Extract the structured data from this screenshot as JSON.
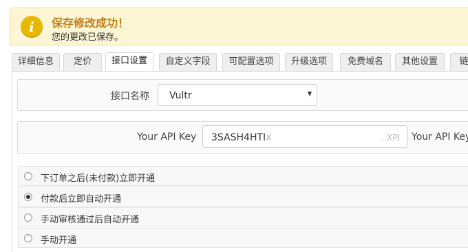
{
  "banner": {
    "icon": "info-icon",
    "icon_glyph": "i",
    "title": "保存修改成功！",
    "subtitle": "您的更改已保存。",
    "title_color": "#c47e18",
    "background": "#fdf6d4"
  },
  "tabs": [
    {
      "label": "详细信息",
      "active": false
    },
    {
      "label": "定价",
      "active": false
    },
    {
      "label": "接口设置",
      "active": true
    },
    {
      "label": "自定义字段",
      "active": false
    },
    {
      "label": "可配置选项",
      "active": false
    },
    {
      "label": "升级选项",
      "active": false
    },
    {
      "label": "免费域名",
      "active": false
    },
    {
      "label": "其他设置",
      "active": false
    },
    {
      "label": "链",
      "active": false
    }
  ],
  "module": {
    "label": "接口名称",
    "selected": "Vultr"
  },
  "api_key": {
    "label": "Your API Key",
    "value_visible": "3SASH4HTI",
    "value_faint": "XZI",
    "tail": "..XPI",
    "trailing_label": "Your API Key"
  },
  "provisioning": {
    "options": [
      {
        "label": "下订单之后(未付款)立即开通",
        "checked": false
      },
      {
        "label": "付款后立即自动开通",
        "checked": true
      },
      {
        "label": "手动审核通过后自动开通",
        "checked": false
      },
      {
        "label": "手动开通",
        "checked": false
      }
    ]
  }
}
